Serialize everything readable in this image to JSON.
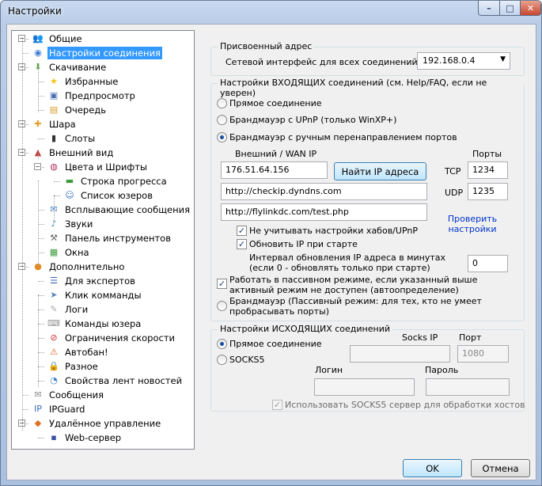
{
  "window": {
    "title": "Настройки",
    "min": "–",
    "max": "□",
    "close": "✕"
  },
  "tree": [
    {
      "label": "Общие",
      "icon": "people-icon"
    },
    {
      "label": "Настройки соединения",
      "icon": "globe-icon",
      "selected": true
    },
    {
      "label": "Скачивание",
      "icon": "download-globe-icon"
    },
    {
      "label": "Избранные",
      "icon": "star-icon"
    },
    {
      "label": "Предпросмотр",
      "icon": "preview-icon"
    },
    {
      "label": "Очередь",
      "icon": "queue-icon"
    },
    {
      "label": "Шара",
      "icon": "share-icon"
    },
    {
      "label": "Слоты",
      "icon": "bars-icon"
    },
    {
      "label": "Внешний вид",
      "icon": "paint-icon"
    },
    {
      "label": "Цвета и Шрифты",
      "icon": "palette-icon"
    },
    {
      "label": "Строка прогресса",
      "icon": "progress-icon"
    },
    {
      "label": "Список юзеров",
      "icon": "users-icon"
    },
    {
      "label": "Всплывающие сообщения",
      "icon": "popup-icon"
    },
    {
      "label": "Звуки",
      "icon": "sound-icon"
    },
    {
      "label": "Панель инструментов",
      "icon": "toolbar-icon"
    },
    {
      "label": "Окна",
      "icon": "windows-icon"
    },
    {
      "label": "Дополнительно",
      "icon": "advanced-icon"
    },
    {
      "label": "Для экспертов",
      "icon": "expert-icon"
    },
    {
      "label": "Клик комманды",
      "icon": "click-command-icon"
    },
    {
      "label": "Логи",
      "icon": "log-icon"
    },
    {
      "label": "Команды юзера",
      "icon": "user-commands-icon"
    },
    {
      "label": "Ограничения скорости",
      "icon": "speed-limit-icon"
    },
    {
      "label": "Автобан!",
      "icon": "autoban-icon"
    },
    {
      "label": "Разное",
      "icon": "lock-icon"
    },
    {
      "label": "Свойства лент новостей",
      "icon": "rss-icon"
    },
    {
      "label": "Сообщения",
      "icon": "messages-icon"
    },
    {
      "label": "IPGuard",
      "icon": "ipguard-icon"
    },
    {
      "label": "Удалённое управление",
      "icon": "remote-icon"
    },
    {
      "label": "Web-сервер",
      "icon": "web-server-icon"
    }
  ],
  "assigned": {
    "title": "Присвоенный адрес",
    "label": "Сетевой интерфейс для всех соединений",
    "value": "192.168.0.4"
  },
  "incoming": {
    "title": "Настройки ВХОДЯЩИХ соединений (см. Help/FAQ, если не уверен)",
    "direct": "Прямое соединение",
    "upnp": "Брандмауэр с UPnP (только WinXP+)",
    "manual": "Брандмауэр с ручным перенаправлением портов",
    "wan_label": "Внешний / WAN IP",
    "ports_label": "Порты",
    "wan_ip": "176.51.64.156",
    "find_ip_button": "Найти IP адреса",
    "tcp_label": "TCP",
    "tcp": "1234",
    "udp_label": "UDP",
    "udp": "1235",
    "url1": "http://checkip.dyndns.com",
    "url2": "http://flylinkdc.com/test.php",
    "check_link": "Проверить настройки",
    "ignore_upnp": "Не учитывать настройки хабов/UPnP",
    "update_ip": "Обновить IP при старте",
    "interval_label": "Интервал обновления IP адреса в минутах (если 0 - обновлять только при старте)",
    "interval": "0",
    "passive_check": "Работать в пассивном режиме, если указанный выше активный режим не доступен (автоопределение)",
    "passive_radio": "Брандмауэр (Пассивный режим: для тех, кто не умеет пробрасывать порты)"
  },
  "outgoing": {
    "title": "Настройки ИСХОДЯЩИХ соединений",
    "direct": "Прямое соединение",
    "socks5": "SOCKS5",
    "socks_ip_label": "Socks IP",
    "port_label": "Порт",
    "port": "1080",
    "login_label": "Логин",
    "password_label": "Пароль",
    "use_socks": "Использовать SOCKS5 сервер для обработки хостов"
  },
  "buttons": {
    "ok": "OK",
    "cancel": "Отмена"
  }
}
